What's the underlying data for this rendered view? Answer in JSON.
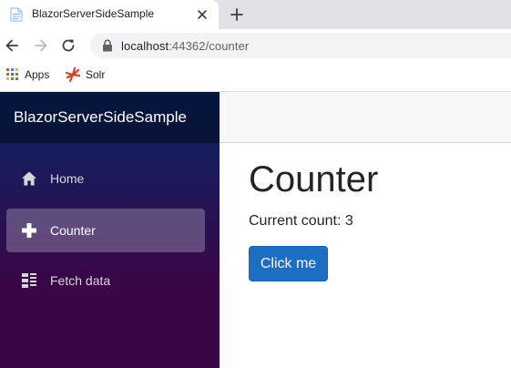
{
  "browser": {
    "tab": {
      "title": "BlazorServerSideSample"
    },
    "address": {
      "host": "localhost",
      "port_path": ":44362/counter"
    },
    "bookmarks": [
      {
        "label": "Apps",
        "icon": "apps-grid-icon"
      },
      {
        "label": "Solr",
        "icon": "solr-icon"
      }
    ]
  },
  "app": {
    "brand": "BlazorServerSideSample",
    "nav": [
      {
        "label": "Home",
        "icon": "home-icon",
        "active": false
      },
      {
        "label": "Counter",
        "icon": "plus-icon",
        "active": true
      },
      {
        "label": "Fetch data",
        "icon": "list-icon",
        "active": false
      }
    ],
    "page": {
      "title": "Counter",
      "count_label": "Current count: ",
      "count_value": "3",
      "button_label": "Click me"
    },
    "colors": {
      "sidebar_top": "#052767",
      "sidebar_bottom": "#3a0647",
      "button": "#1b6ec2"
    }
  }
}
